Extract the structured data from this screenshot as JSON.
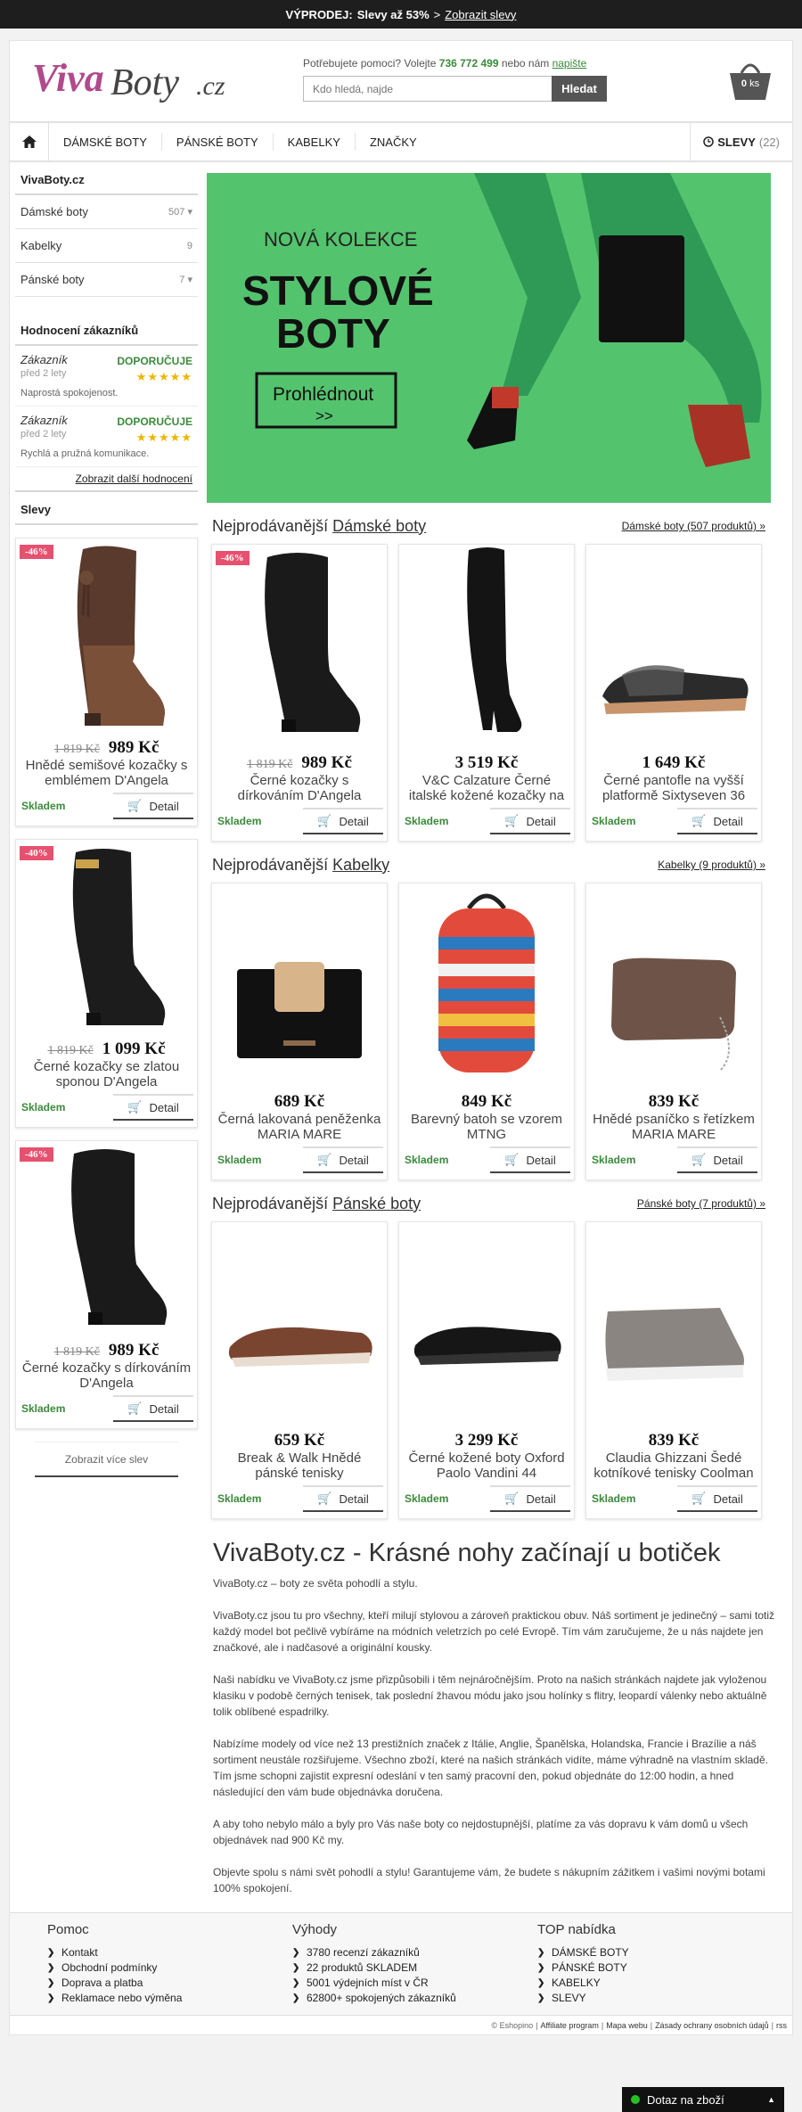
{
  "topbar": {
    "label": "VÝPRODEJ:",
    "text": "Slevy až 53%",
    "sep": ">",
    "link": "Zobrazit slevy"
  },
  "header": {
    "logo_text": "VivaBoty.cz",
    "help_prefix": "Potřebujete pomoci? Volejte",
    "phone": "736 772 499",
    "help_mid": "nebo nám",
    "help_link": "napište",
    "search_placeholder": "Kdo hledá, najde",
    "search_button": "Hledat",
    "cart_value": "0",
    "cart_unit": "ks"
  },
  "nav": {
    "items": [
      "DÁMSKÉ BOTY",
      "PÁNSKÉ BOTY",
      "KABELKY",
      "ZNAČKY"
    ],
    "sale_label": "SLEVY",
    "sale_count": "(22)",
    "home_icon": "home-icon"
  },
  "sidebar": {
    "title": "VivaBoty.cz",
    "categories": [
      {
        "label": "Dámské boty",
        "count": "507"
      },
      {
        "label": "Kabelky",
        "count": "9"
      },
      {
        "label": "Pánské boty",
        "count": "7"
      }
    ],
    "reviews_title": "Hodnocení zákazníků",
    "reviews": [
      {
        "who": "Zákazník",
        "when": "před 2 lety",
        "rec": "DOPORUČUJE",
        "stars": "★★★★★",
        "text": "Naprostá spokojenost."
      },
      {
        "who": "Zákazník",
        "when": "před 2 lety",
        "rec": "DOPORUČUJE",
        "stars": "★★★★★",
        "text": "Rychlá a pružná komunikace."
      }
    ],
    "more_reviews": "Zobrazit další hodnocení",
    "sale_title": "Slevy",
    "sale_products": [
      {
        "badge": "-46%",
        "old": "1 819 Kč",
        "price": "989 Kč",
        "name": "Hnědé semišové kozačky s emblémem D'Angela",
        "stock": "Skladem",
        "btn": "Detail"
      },
      {
        "badge": "-40%",
        "old": "1 819 Kč",
        "price": "1 099 Kč",
        "name": "Černé kozačky se zlatou sponou D'Angela",
        "stock": "Skladem",
        "btn": "Detail"
      },
      {
        "badge": "-46%",
        "old": "1 819 Kč",
        "price": "989 Kč",
        "name": "Černé kozačky s dírkováním D'Angela",
        "stock": "Skladem",
        "btn": "Detail"
      }
    ],
    "show_more": "Zobrazit více slev"
  },
  "banner": {
    "line1": "NOVÁ KOLEKCE",
    "line2": "STYLOVÉ",
    "line3": "BOTY",
    "cta": "Prohlédnout",
    "cta2": ">>"
  },
  "sections": [
    {
      "prefix": "Nejprodávanější",
      "title": "Dámské boty",
      "more": "Dámské boty (507 produktů)",
      "products": [
        {
          "badge": "-46%",
          "old": "1 819 Kč",
          "price": "989 Kč",
          "name": "Černé kozačky s dírkováním D'Angela",
          "stock": "Skladem",
          "btn": "Detail"
        },
        {
          "badge": "",
          "old": "",
          "price": "3 519 Kč",
          "name": "V&C Calzature Černé italské kožené kozačky na",
          "stock": "Skladem",
          "btn": "Detail"
        },
        {
          "badge": "",
          "old": "",
          "price": "1 649 Kč",
          "name": "Černé pantofle na vyšší platformě Sixtyseven 36",
          "stock": "Skladem",
          "btn": "Detail"
        }
      ]
    },
    {
      "prefix": "Nejprodávanější",
      "title": "Kabelky",
      "more": "Kabelky (9 produktů)",
      "products": [
        {
          "badge": "",
          "old": "",
          "price": "689 Kč",
          "name": "Černá lakovaná peněženka MARIA MARE",
          "stock": "Skladem",
          "btn": "Detail"
        },
        {
          "badge": "",
          "old": "",
          "price": "849 Kč",
          "name": "Barevný batoh se vzorem MTNG",
          "stock": "Skladem",
          "btn": "Detail"
        },
        {
          "badge": "",
          "old": "",
          "price": "839 Kč",
          "name": "Hnědé psaníčko s řetízkem MARIA MARE",
          "stock": "Skladem",
          "btn": "Detail"
        }
      ]
    },
    {
      "prefix": "Nejprodávanější",
      "title": "Pánské boty",
      "more": "Pánské boty (7 produktů)",
      "products": [
        {
          "badge": "",
          "old": "",
          "price": "659 Kč",
          "name": "Break & Walk Hnědé pánské tenisky",
          "stock": "Skladem",
          "btn": "Detail"
        },
        {
          "badge": "",
          "old": "",
          "price": "3 299 Kč",
          "name": "Černé kožené boty Oxford Paolo Vandini 44",
          "stock": "Skladem",
          "btn": "Detail"
        },
        {
          "badge": "",
          "old": "",
          "price": "839 Kč",
          "name": "Claudia Ghizzani Šedé kotníkové tenisky Coolman",
          "stock": "Skladem",
          "btn": "Detail"
        }
      ]
    }
  ],
  "about": {
    "title": "VivaBoty.cz - Krásné nohy začínají u botiček",
    "paragraphs": [
      "VivaBoty.cz – boty ze světa pohodlí a stylu.",
      "VivaBoty.cz jsou tu pro všechny, kteří milují stylovou a zároveň praktickou obuv. Náš sortiment je jedinečný – sami totiž každý model bot pečlivě vybíráme na módních veletrzích po celé Evropě. Tím vám zaručujeme, že u nás najdete jen značkové, ale i nadčasové a originální kousky.",
      "Naši nabídku ve VivaBoty.cz jsme přizpůsobili i těm nejnáročnějším. Proto na našich stránkách najdete jak vyloženou klasiku v podobě černých tenisek, tak poslední žhavou módu jako jsou holínky s flitry, leopardí válenky nebo aktuálně tolik oblíbené espadrilky.",
      "Nabízíme modely od více než 13 prestižních značek z Itálie, Anglie, Španělska, Holandska, Francie i Brazílie a náš sortiment neustále rozšiřujeme. Všechno zboží, které na našich stránkách vidíte, máme výhradně na vlastním skladě. Tím jsme schopni zajistit expresní odeslání v ten samý pracovní den, pokud objednáte do 12:00 hodin, a hned následující den vám bude objednávka doručena.",
      "A aby toho nebylo málo a byly pro Vás naše boty co nejdostupnější, platíme za vás dopravu k vám domů u všech objednávek nad 900 Kč my.",
      "Objevte spolu s námi svět pohodlí a stylu! Garantujeme vám, že budete s nákupním zážitkem i vašimi novými botami 100% spokojení."
    ]
  },
  "footer": {
    "cols": [
      {
        "title": "Pomoc",
        "items": [
          "Kontakt",
          "Obchodní podmínky",
          "Doprava a platba",
          "Reklamace nebo výměna"
        ]
      },
      {
        "title": "Výhody",
        "items": [
          "3780 recenzí zákazníků",
          "22 produktů SKLADEM",
          "5001 výdejních míst v ČR",
          "62800+ spokojených zákazníků"
        ]
      },
      {
        "title": "TOP nabídka",
        "items": [
          "DÁMSKÉ BOTY",
          "PÁNSKÉ BOTY",
          "KABELKY",
          "SLEVY"
        ]
      }
    ],
    "copy": "© Eshopino",
    "links": [
      "Affiliate program",
      "Mapa webu",
      "Zásady ochrany osobních údajů",
      "rss"
    ],
    "seps": [
      "|",
      "|",
      "|",
      "|"
    ]
  },
  "chat": {
    "label": "Dotaz na zboží"
  },
  "colors": {
    "accent_green": "#3a8a3a",
    "badge_pink": "#e7516f",
    "logo_purple": "#b04a8c",
    "banner_green": "#4fbf6a"
  }
}
